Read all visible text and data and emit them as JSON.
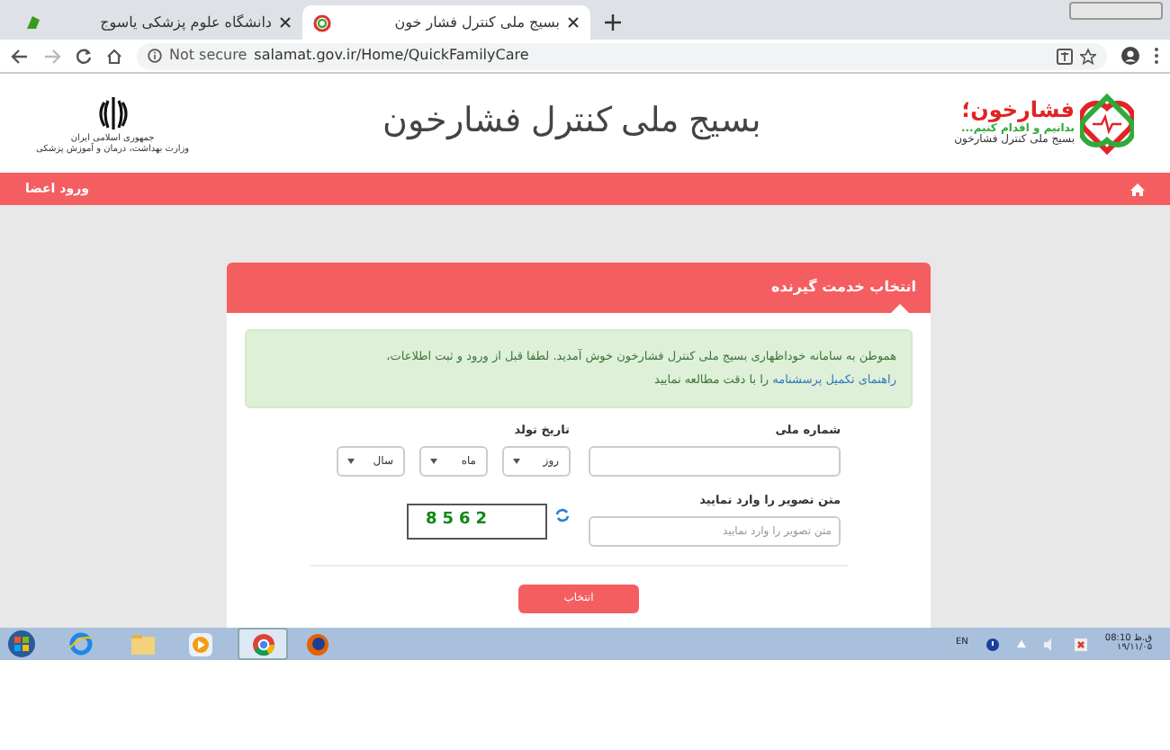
{
  "browser": {
    "tabs": [
      {
        "title": "بسیج ملی کنترل فشار خون",
        "selected": true
      },
      {
        "title": "دانشگاه علوم پزشکی یاسوج",
        "selected": false
      }
    ],
    "security": "Not secure",
    "url_host": "salamat.gov.ir",
    "url_path": "/Home/QuickFamilyCare"
  },
  "header": {
    "title": "بسیج ملی کنترل فشارخون",
    "logo_lines": [
      "فشارخون؛",
      "بدانیم و اقدام کنیم...",
      "بسیج ملی کنترل فشارخون"
    ],
    "emblem_lines": [
      "جمهوری اسلامی ایران",
      "وزارت بهداشت، درمان و آموزش پزشکی"
    ]
  },
  "navbar": {
    "login": "ورود اعضا"
  },
  "panel": {
    "title": "انتخاب خدمت گیرنده",
    "alert": {
      "before": "هموطن به سامانه خوداظهاری بسیج ملی کنترل فشارخون خوش آمدید. لطفا قبل از ورود و ثبت اطلاعات، ",
      "link": "راهنمای تکمیل پرسشنامه",
      "after": " را با دقت مطالعه نمایید"
    },
    "national_id_label": "شماره ملی",
    "birth_date_label": "تاریخ تولد",
    "birth_selects": [
      "روز",
      "ماه",
      "سال"
    ],
    "captcha_label": "متن تصویر را وارد نمایید",
    "captcha_placeholder": "متن تصویر را وارد نمایید",
    "captcha_text": "8562",
    "submit": "انتخاب"
  },
  "taskbar": {
    "language": "EN",
    "time": "ق.ظ 08:10",
    "date": "۱۹/۱۱/۰۵"
  }
}
